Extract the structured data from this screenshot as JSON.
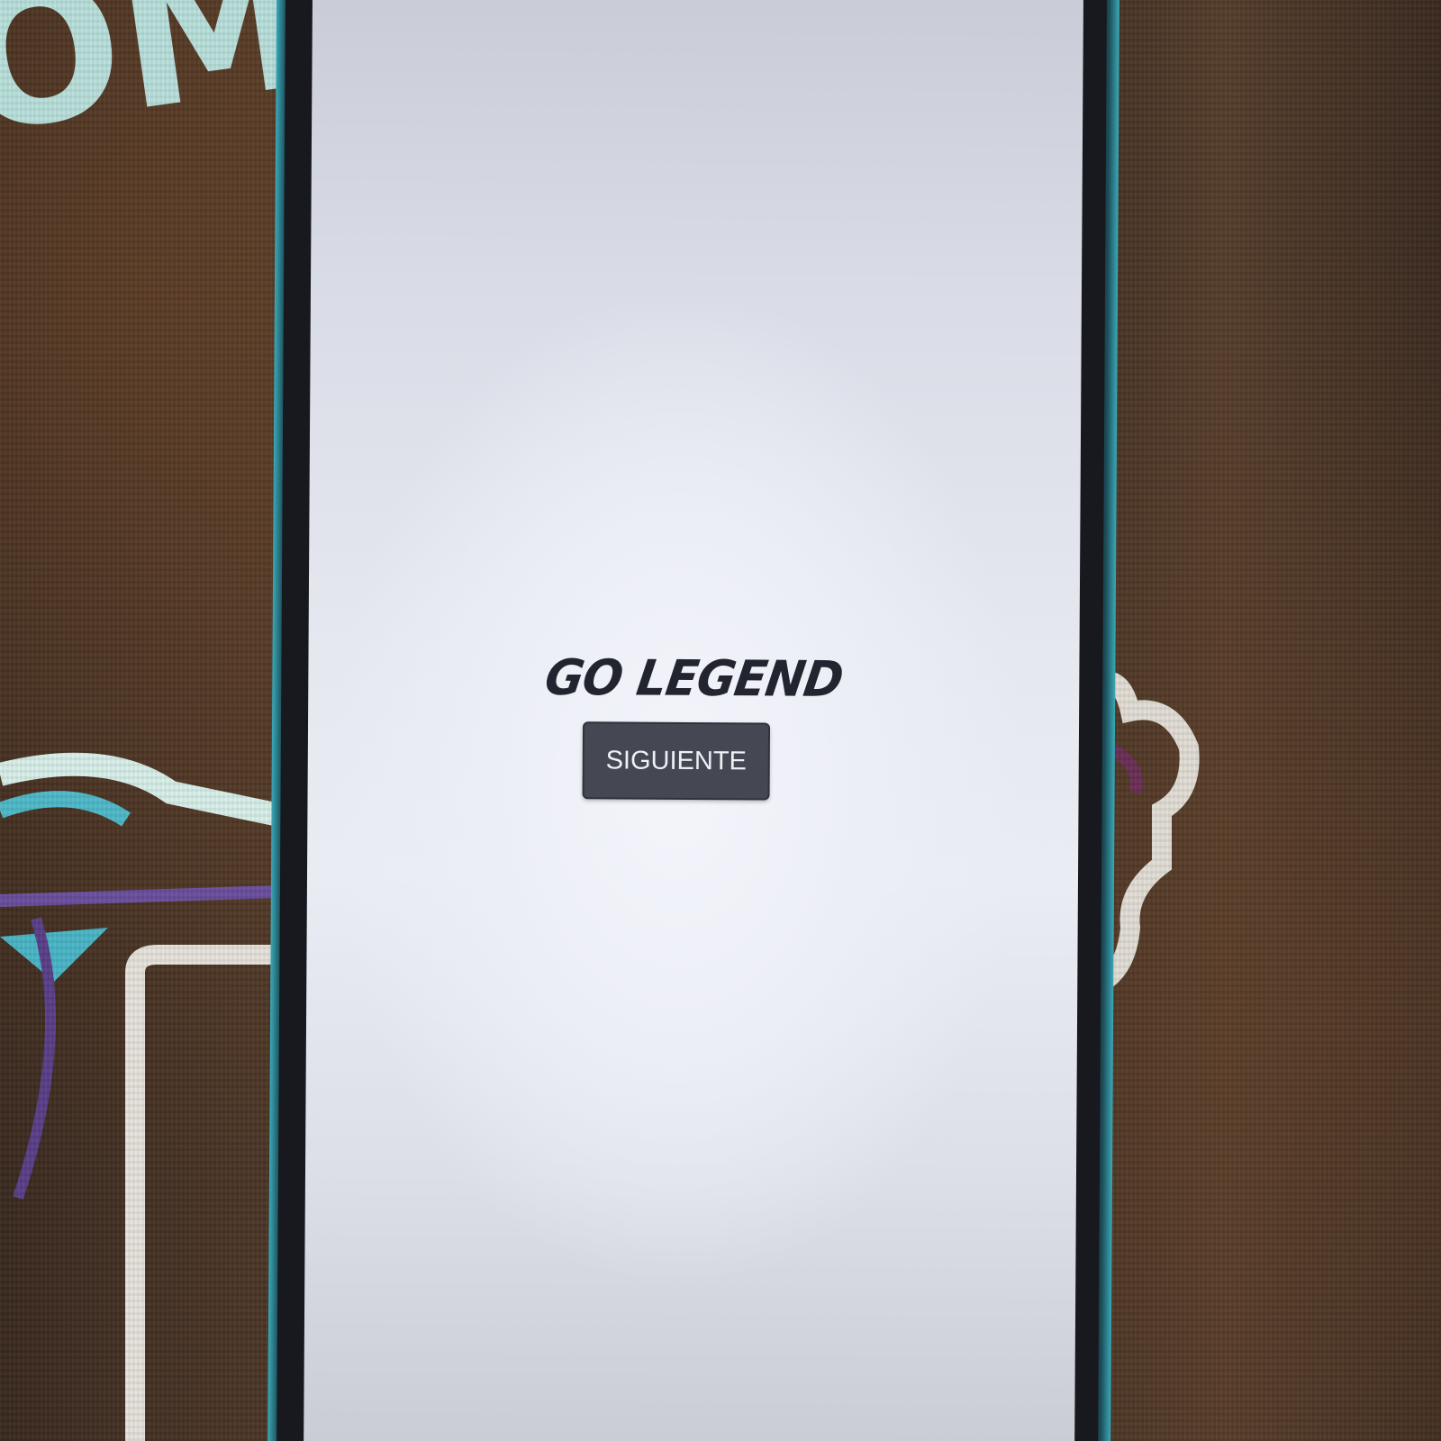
{
  "app": {
    "logo_text": "GO LEGEND",
    "next_button_label": "SIGUIENTE"
  },
  "background": {
    "shirt_print_text": "OMM"
  },
  "colors": {
    "screen_background": "#e9ebf3",
    "logo": "#22252f",
    "button_background": "#454853",
    "button_text": "#eef0f4",
    "phone_frame_accent": "#3aa9b8"
  }
}
